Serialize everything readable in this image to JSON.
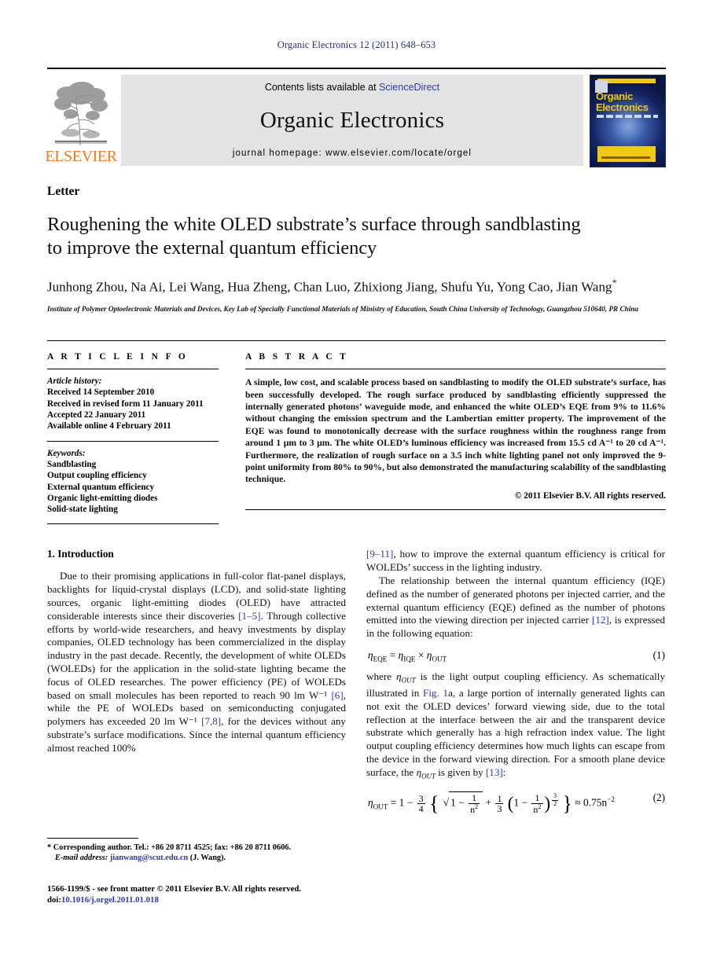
{
  "running_head": "Organic Electronics 12 (2011) 648–653",
  "masthead": {
    "publisher_name": "ELSEVIER",
    "contents_prefix": "Contents lists available at ",
    "contents_link": "ScienceDirect",
    "journal_name": "Organic Electronics",
    "homepage": "journal homepage: www.elsevier.com/locate/orgel",
    "cover_title_line1": "Organic",
    "cover_title_line2": "Electronics"
  },
  "article": {
    "type_label": "Letter",
    "title_line1": "Roughening the white OLED substrate’s surface through sandblasting",
    "title_line2": "to improve the external quantum efficiency",
    "authors": "Junhong Zhou, Na Ai, Lei Wang, Hua Zheng, Chan Luo, Zhixiong Jiang, Shufu Yu, Yong Cao, Jian Wang",
    "corresponding_marker": "*",
    "affiliation": "Institute of Polymer Optoelectronic Materials and Devices, Key Lab of Specially Functional Materials of Ministry of Education, South China University of Technology, Guangzhou 510640, PR China"
  },
  "article_info": {
    "heading": "A R T I C L E   I N F O",
    "history_label": "Article history:",
    "history": [
      "Received 14 September 2010",
      "Received in revised form 11 January 2011",
      "Accepted 22 January 2011",
      "Available online 4 February 2011"
    ],
    "keywords_label": "Keywords:",
    "keywords": [
      "Sandblasting",
      "Output coupling efficiency",
      "External quantum efficiency",
      "Organic light-emitting diodes",
      "Solid-state lighting"
    ]
  },
  "abstract": {
    "heading": "A B S T R A C T",
    "text": "A simple, low cost, and scalable process based on sandblasting to modify the OLED substrate’s surface, has been successfully developed. The rough surface produced by sandblasting efficiently suppressed the internally generated photons’ waveguide mode, and enhanced the white OLED’s EQE from 9% to 11.6% without changing the emission spectrum and the Lambertian emitter property. The improvement of the EQE was found to monotonically decrease with the surface roughness within the roughness range from around 1 µm to 3 µm. The white OLED’s luminous efficiency was increased from 15.5 cd A⁻¹ to 20 cd A⁻¹. Furthermore, the realization of rough surface on a 3.5 inch white lighting panel not only improved the 9-point uniformity from 80% to 90%, but also demonstrated the manufacturing scalability of the sandblasting technique.",
    "copyright": "© 2011 Elsevier B.V. All rights reserved."
  },
  "body": {
    "section1_heading": "1. Introduction",
    "para1_a": "Due to their promising applications in full-color flat-panel displays, backlights for liquid-crystal displays (LCD), and solid-state lighting sources, organic light-emitting diodes (OLED) have attracted considerable interests since their discoveries ",
    "para1_ref1": "[1–5]",
    "para1_b": ". Through collective efforts by world-wide researchers, and heavy investments by display companies, OLED technology has been commercialized in the display industry in the past decade. Recently, the development of white OLEDs (WOLEDs) for the application in the solid-state lighting became the focus of OLED researches. The power efficiency (PE) of WOLEDs based on small molecules has been reported to reach 90 lm W⁻¹ ",
    "para1_ref2": "[6]",
    "para1_c": ", while the PE of WOLEDs based on semiconducting conjugated polymers has exceeded 20 lm W⁻¹ ",
    "para1_ref3": "[7,8]",
    "para1_d": ", for the devices without any substrate’s surface modifications. Since the internal quantum efficiency almost reached 100% ",
    "para1_ref4": "[9–11]",
    "para1_e": ", how to improve the external quantum efficiency is critical for WOLEDs’ success in the lighting industry.",
    "para2_a": "The relationship between the internal quantum efficiency (IQE) defined as the number of generated photons per injected carrier, and the external quantum efficiency (EQE) defined as the number of photons emitted into the viewing direction per injected carrier ",
    "para2_ref1": "[12]",
    "para2_b": ", is expressed in the following equation:",
    "eq1_number": "(1)",
    "para3_a": "where ",
    "para3_b": " is the light output coupling efficiency. As schematically illustrated in ",
    "para3_figref": "Fig. 1",
    "para3_c": "a, a large portion of internally generated lights can not exit the OLED devices’ forward viewing side, due to the total reflection at the interface between the air and the transparent device substrate which generally has a high refraction index value. The light output coupling efficiency determines how much lights can escape from the device in the forward viewing direction. For a smooth plane device surface, the ",
    "para3_d": " is given by ",
    "para3_ref": "[13]",
    "para3_e": ":",
    "eq2_number": "(2)"
  },
  "footnote": {
    "marker": "*",
    "text": " Corresponding author. Tel.: +86 20 8711 4525; fax: +86 20 8711 0606.",
    "email_label": "E-mail address:",
    "email": "jianwang@scut.edu.cn",
    "email_suffix": " (J. Wang)."
  },
  "footer": {
    "line1": "1566-1199/$ - see front matter © 2011 Elsevier B.V. All rights reserved.",
    "doi_label": "doi:",
    "doi": "10.1016/j.orgel.2011.01.018"
  },
  "colors": {
    "link": "#2b3bb5",
    "running_head": "#2b2f7a",
    "elsevier_orange": "#ef7d22",
    "band_gray": "#e3e3e3",
    "cover_yellow": "#f3c815",
    "cover_blue": "#24408f"
  }
}
